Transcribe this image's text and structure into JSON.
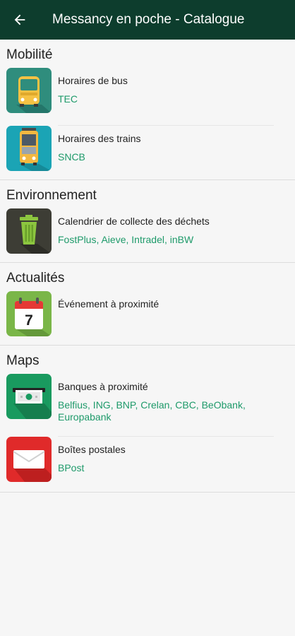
{
  "appbar": {
    "title": "Messancy en poche - Catalogue",
    "back_icon": "arrow-back-icon"
  },
  "colors": {
    "appbar_bg": "#0d3d2d",
    "subtitle": "#1e9a6a",
    "bus_bg": "#2f8d7d",
    "train_bg": "#1ba4b5",
    "trash_bg": "#3d3d35",
    "calendar_bg": "#7ab648",
    "bank_bg": "#199a5f",
    "post_bg": "#e02a2a"
  },
  "sections": [
    {
      "title": "Mobilité",
      "items": [
        {
          "name": "Horaires de bus",
          "sub": "TEC",
          "icon": "bus-icon"
        },
        {
          "name": "Horaires des trains",
          "sub": "SNCB",
          "icon": "train-icon"
        }
      ]
    },
    {
      "title": "Environnement",
      "items": [
        {
          "name": "Calendrier de collecte des déchets",
          "sub": "FostPlus, Aieve, Intradel, inBW",
          "icon": "trash-icon"
        }
      ]
    },
    {
      "title": "Actualités",
      "items": [
        {
          "name": "Événement à proximité",
          "sub": "",
          "icon": "calendar-icon",
          "calendar_day": "7"
        }
      ]
    },
    {
      "title": "Maps",
      "items": [
        {
          "name": "Banques à proximité",
          "sub": "Belfius, ING, BNP, Crelan, CBC, BeObank, Europabank",
          "icon": "banknote-icon"
        },
        {
          "name": "Boîtes postales",
          "sub": "BPost",
          "icon": "envelope-icon"
        }
      ]
    }
  ]
}
